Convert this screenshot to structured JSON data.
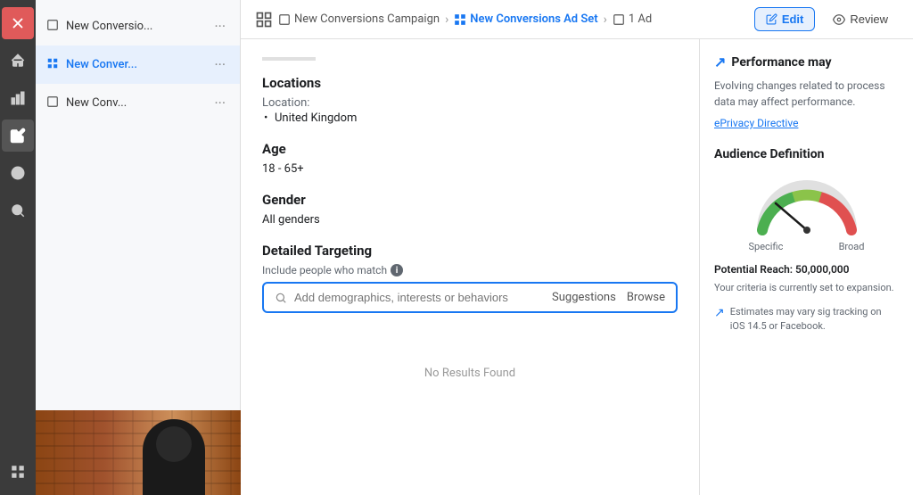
{
  "sidebar": {
    "icons": [
      {
        "name": "close-icon",
        "label": "X",
        "type": "close"
      },
      {
        "name": "home-icon",
        "label": "⌂",
        "type": "home"
      },
      {
        "name": "chart-icon",
        "label": "📊",
        "type": "chart"
      },
      {
        "name": "edit-icon",
        "label": "✏",
        "type": "edit",
        "active": true
      },
      {
        "name": "clock-icon",
        "label": "🕐",
        "type": "clock"
      },
      {
        "name": "search-icon",
        "label": "🔍",
        "type": "search"
      },
      {
        "name": "grid-icon",
        "label": "⊞",
        "type": "grid"
      }
    ]
  },
  "campaign_nav": {
    "items": [
      {
        "id": "campaign",
        "icon": "□",
        "label": "New Conversio...",
        "more": "···",
        "active": false
      },
      {
        "id": "adset",
        "icon": "⊞",
        "label": "New Conver...",
        "more": "···",
        "active": true
      },
      {
        "id": "ad",
        "icon": "□",
        "label": "New Conv...",
        "more": "···",
        "active": false
      }
    ]
  },
  "breadcrumb": {
    "items": [
      {
        "label": "New Conversions Campaign",
        "active": false,
        "icon": "□"
      },
      {
        "label": "New Conversions Ad Set",
        "active": true,
        "icon": "⊞"
      },
      {
        "label": "1 Ad",
        "active": false,
        "icon": "□"
      }
    ],
    "separator": "›"
  },
  "toolbar": {
    "edit_label": "Edit",
    "review_label": "Review"
  },
  "main": {
    "scroll_indicator": true,
    "locations_section": {
      "title": "Locations",
      "label": "Location:",
      "values": [
        "United Kingdom"
      ]
    },
    "age_section": {
      "title": "Age",
      "value": "18 - 65+"
    },
    "gender_section": {
      "title": "Gender",
      "value": "All genders"
    },
    "targeting_section": {
      "title": "Detailed Targeting",
      "include_label": "Include people who match",
      "search_placeholder": "Add demographics, interests or behaviors",
      "suggestions_label": "Suggestions",
      "browse_label": "Browse"
    },
    "no_results": "No Results Found"
  },
  "right_sidebar": {
    "performance": {
      "title": "Performance may",
      "icon": "↗",
      "body": "Evolving changes related to process data may affect performance.",
      "link_label": "ePrivacy Directive"
    },
    "audience": {
      "title": "Audience Definition",
      "gauge": {
        "specific_label": "Specific",
        "broad_label": "Broad",
        "needle_angle": 130
      },
      "reach_label": "Potential Reach: 50,000,000",
      "reach_sub": "Your criteria is currently set to expansion.",
      "estimates_text": "Estimates may vary sig tracking on iOS 14.5 or Facebook."
    }
  }
}
